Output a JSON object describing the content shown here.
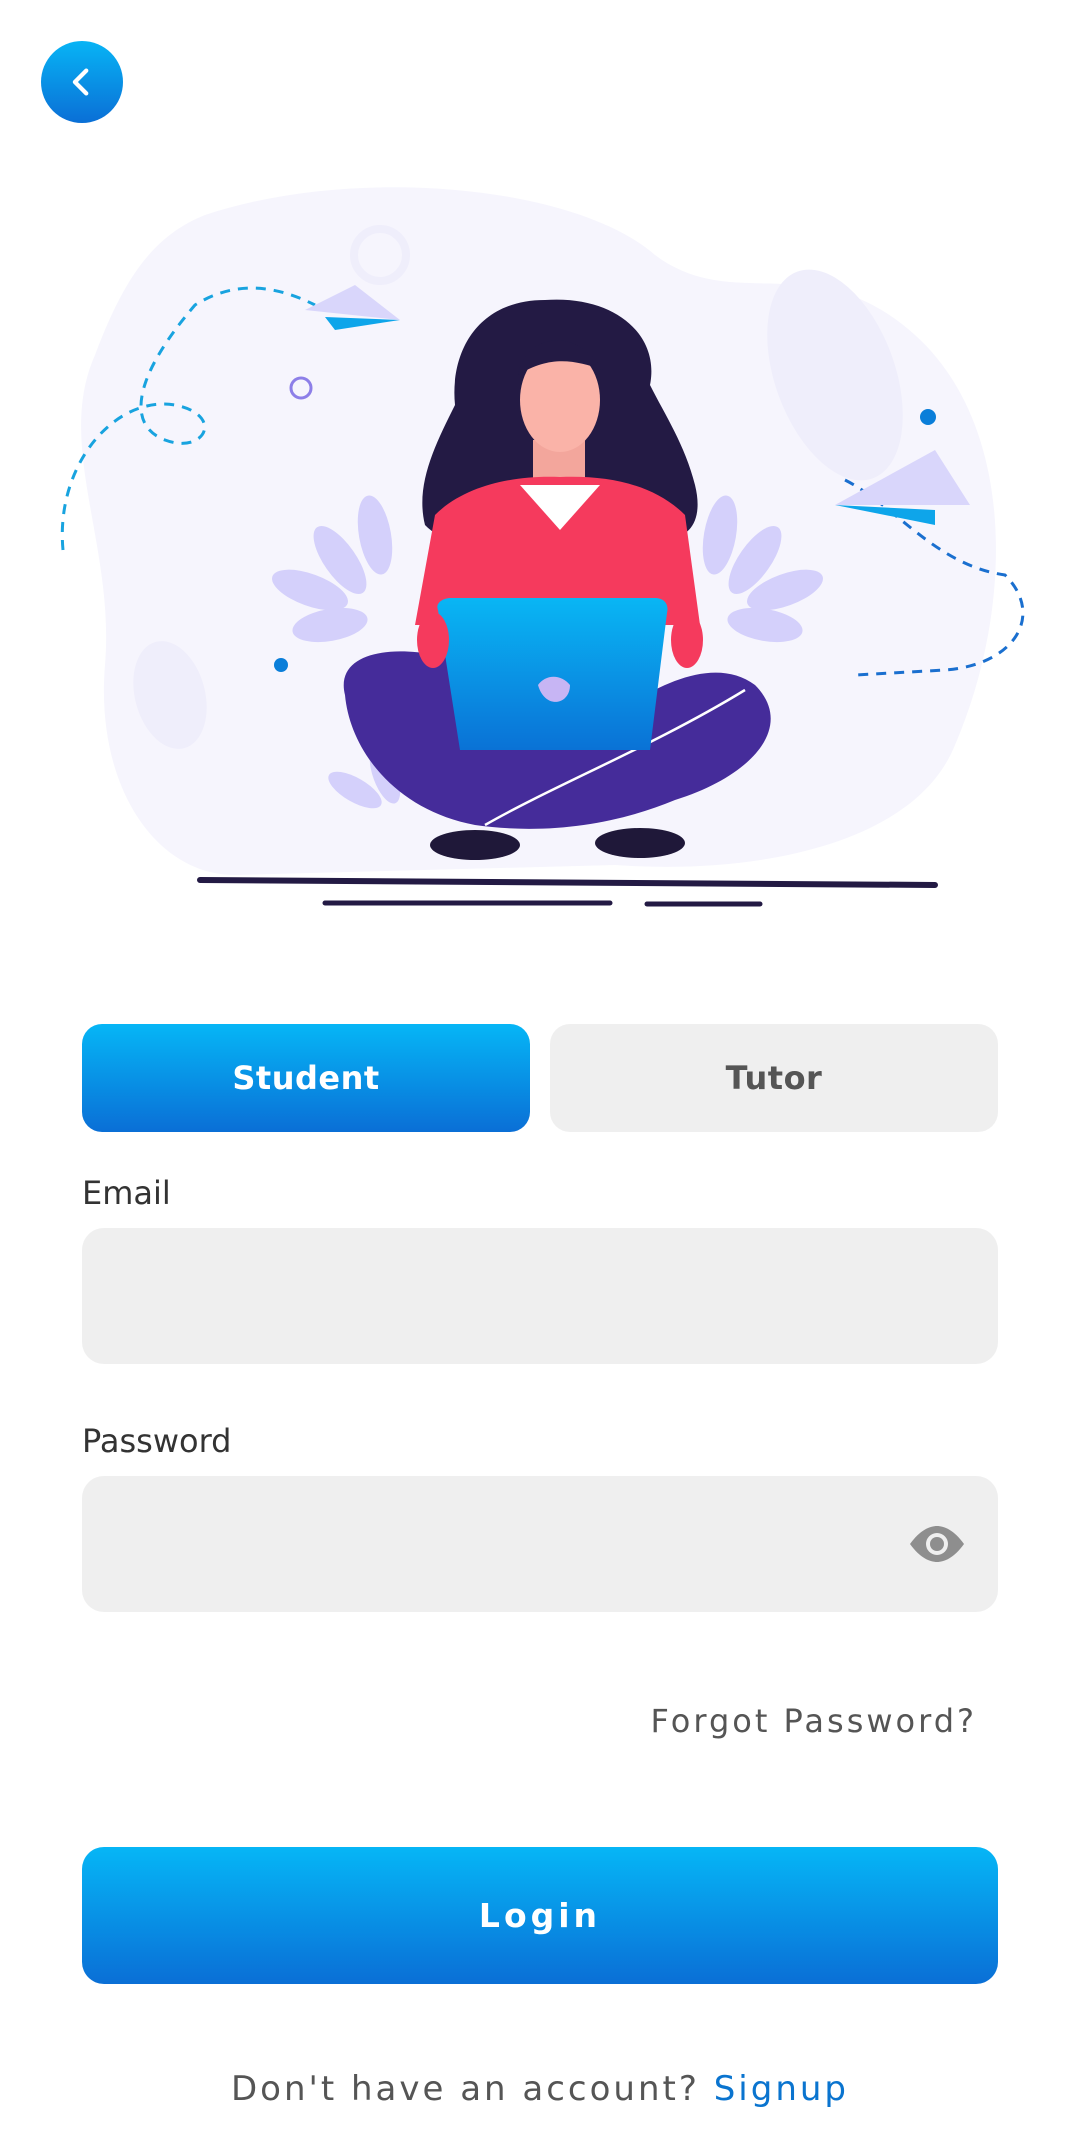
{
  "header": {
    "back_icon": "chevron-left-icon"
  },
  "role_toggle": {
    "options": [
      "Student",
      "Tutor"
    ],
    "selected": "Student"
  },
  "form": {
    "email": {
      "label": "Email",
      "value": ""
    },
    "password": {
      "label": "Password",
      "value": "",
      "toggle_icon": "eye-icon"
    }
  },
  "forgot_password": "Forgot Password?",
  "login_label": "Login",
  "signup": {
    "prompt": "Don't have an account?",
    "link": "Signup"
  },
  "colors": {
    "accent_top": "#06b6f6",
    "accent_bottom": "#0a6fd6",
    "field_bg": "#efefef",
    "link": "#0a74cf"
  }
}
